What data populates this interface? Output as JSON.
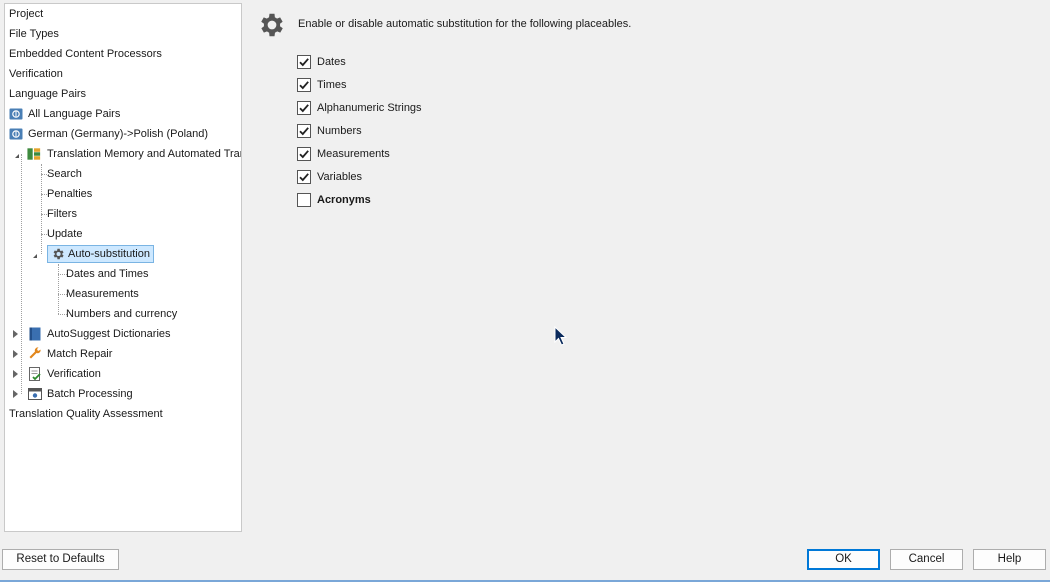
{
  "tree": {
    "items": [
      {
        "label": "Project"
      },
      {
        "label": "File Types"
      },
      {
        "label": "Embedded Content Processors"
      },
      {
        "label": "Verification"
      },
      {
        "label": "Language Pairs"
      },
      {
        "label": "All Language Pairs",
        "icon": "language-pair-icon"
      },
      {
        "label": "German (Germany)->Polish (Poland)",
        "icon": "language-pair-icon"
      },
      {
        "label": "Translation Memory and Automated Translation",
        "icon": "translation-memory-icon"
      },
      {
        "label": "Search"
      },
      {
        "label": "Penalties"
      },
      {
        "label": "Filters"
      },
      {
        "label": "Update"
      },
      {
        "label": "Auto-substitution",
        "icon": "gear-icon",
        "selected": true
      },
      {
        "label": "Dates and Times"
      },
      {
        "label": "Measurements"
      },
      {
        "label": "Numbers and currency"
      },
      {
        "label": "AutoSuggest Dictionaries",
        "icon": "dictionary-icon"
      },
      {
        "label": "Match Repair",
        "icon": "wrench-icon"
      },
      {
        "label": "Verification",
        "icon": "verification-icon"
      },
      {
        "label": "Batch Processing",
        "icon": "batch-processing-icon"
      },
      {
        "label": "Translation Quality Assessment"
      }
    ]
  },
  "main": {
    "description": "Enable or disable automatic substitution for the following placeables.",
    "options": [
      {
        "label": "Dates",
        "checked": true
      },
      {
        "label": "Times",
        "checked": true
      },
      {
        "label": "Alphanumeric Strings",
        "checked": true
      },
      {
        "label": "Numbers",
        "checked": true
      },
      {
        "label": "Measurements",
        "checked": true
      },
      {
        "label": "Variables",
        "checked": true
      },
      {
        "label": "Acronyms",
        "checked": false
      }
    ]
  },
  "footer": {
    "reset_label": "Reset to Defaults",
    "ok_label": "OK",
    "cancel_label": "Cancel",
    "help_label": "Help"
  },
  "colors": {
    "selection": "#cde8ff",
    "accent": "#0078d7"
  }
}
